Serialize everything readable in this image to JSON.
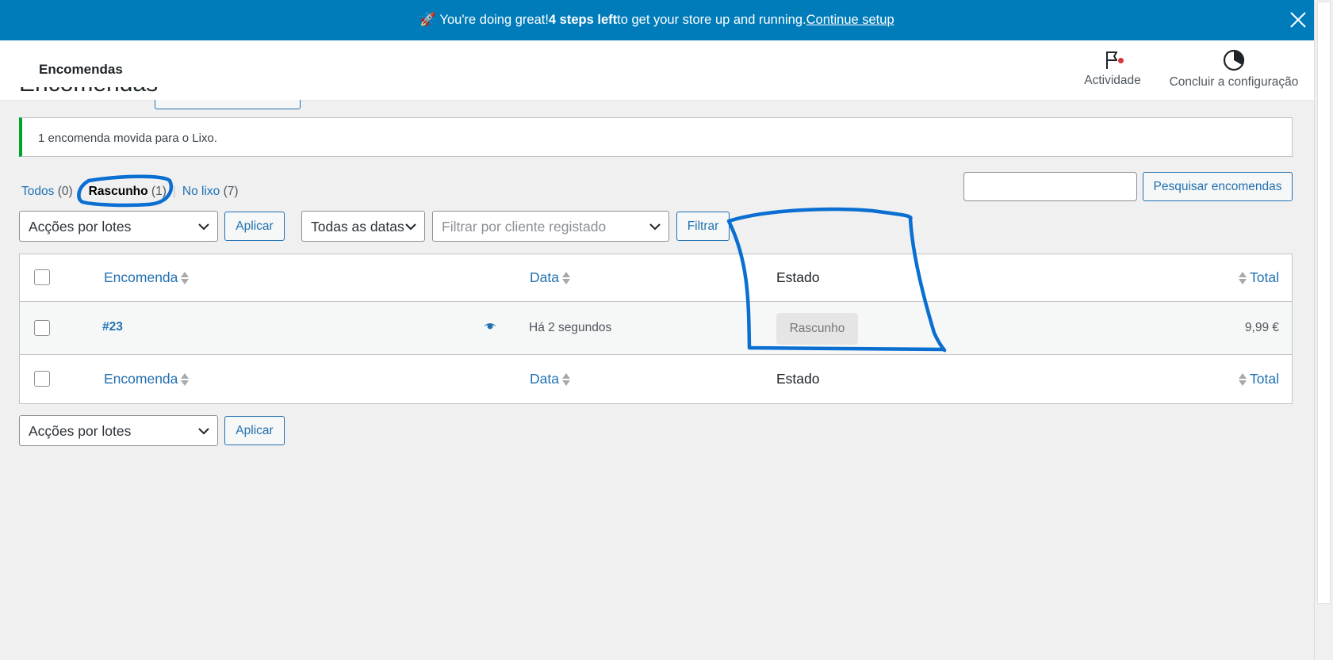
{
  "banner": {
    "emoji": "🚀",
    "text_pre": "You're doing great! ",
    "bold": "4 steps left",
    "text_post": " to get your store up and running. ",
    "link": "Continue setup"
  },
  "header": {
    "title": "Encomendas",
    "activity_label": "Actividade",
    "setup_label": "Concluir a configuração"
  },
  "page": {
    "heading": "Encomendas"
  },
  "notice": {
    "message": "1 encomenda movida para o Lixo."
  },
  "views": [
    {
      "label": "Todos",
      "count": "(0)"
    },
    {
      "label": "Rascunho",
      "count": "(1)"
    },
    {
      "label": "No lixo",
      "count": "(7)"
    }
  ],
  "views_separator": "|",
  "search": {
    "button": "Pesquisar encomendas"
  },
  "filters": {
    "bulk_actions": "Acções por lotes",
    "apply": "Aplicar",
    "dates": "Todas as datas",
    "customer_placeholder": "Filtrar por cliente registado",
    "filter_button": "Filtrar"
  },
  "table": {
    "columns": {
      "order": "Encomenda",
      "date": "Data",
      "status": "Estado",
      "total": "Total"
    },
    "rows": [
      {
        "order": "#23",
        "date": "Há 2 segundos",
        "status": "Rascunho",
        "total": "9,99 €"
      }
    ]
  },
  "bottom": {
    "bulk_actions": "Acções por lotes",
    "apply": "Aplicar"
  },
  "colors": {
    "banner": "#007cba",
    "link": "#2271b1",
    "notice_success": "#00a32a",
    "annotation": "#0a6fd1"
  }
}
